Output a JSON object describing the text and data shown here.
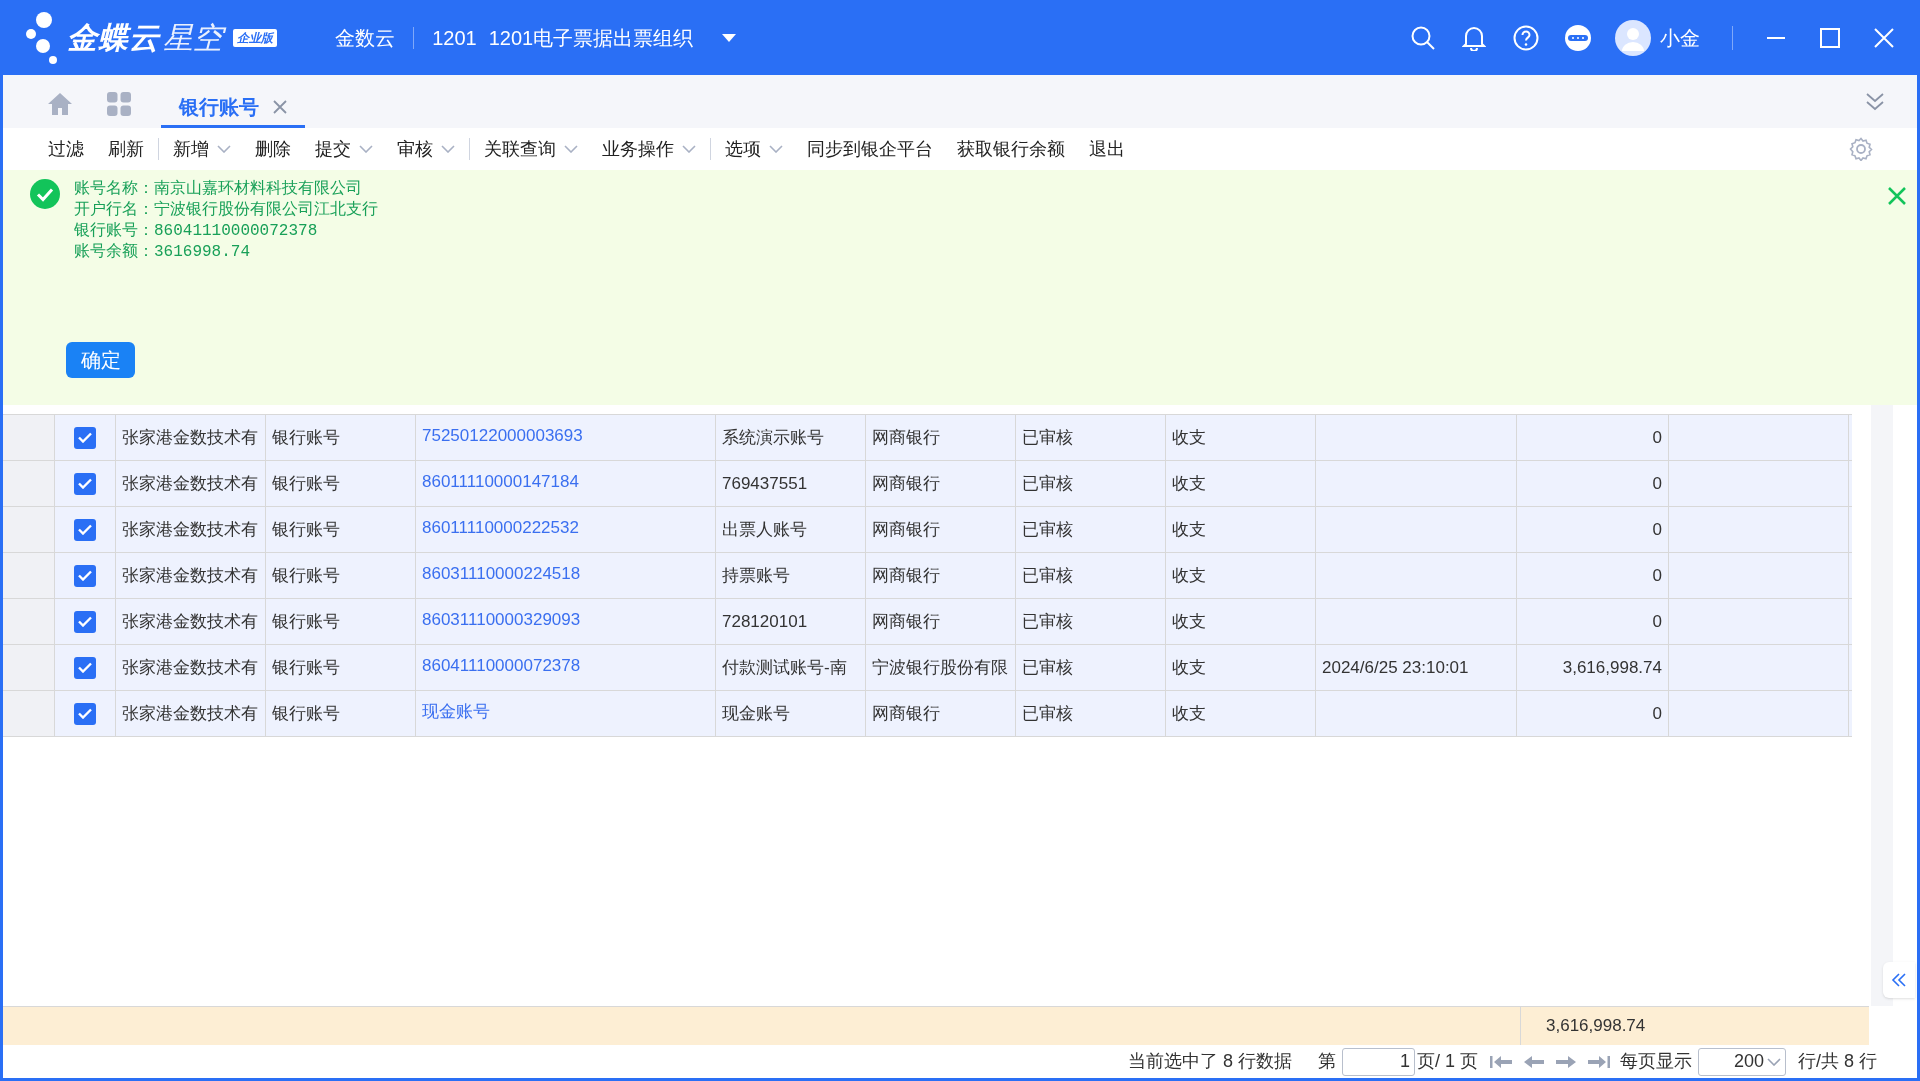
{
  "header": {
    "logo_text": "金蝶云",
    "logo_subtext": "星空",
    "edition_badge": "企业版",
    "org_short": "金数云",
    "org_code": "1201",
    "org_name": "1201电子票据出票组织",
    "user": "小金"
  },
  "tabs": [
    {
      "label": "银行账号",
      "selected": true,
      "closable": true
    }
  ],
  "toolbar": [
    [
      {
        "label": "过滤",
        "dropdown": false
      },
      {
        "label": "刷新",
        "dropdown": false
      }
    ],
    [
      {
        "label": "新增",
        "dropdown": true
      },
      {
        "label": "删除",
        "dropdown": false
      },
      {
        "label": "提交",
        "dropdown": true
      },
      {
        "label": "审核",
        "dropdown": true
      }
    ],
    [
      {
        "label": "关联查询",
        "dropdown": true
      },
      {
        "label": "业务操作",
        "dropdown": true
      }
    ],
    [
      {
        "label": "选项",
        "dropdown": true
      },
      {
        "label": "同步到银企平台",
        "dropdown": false
      },
      {
        "label": "获取银行余额",
        "dropdown": false
      },
      {
        "label": "退出",
        "dropdown": false
      }
    ]
  ],
  "message": {
    "kind": "success",
    "lines": [
      "账号名称：南京山嘉环材料科技有限公司",
      "开户行名：宁波银行股份有限公司江北支行",
      "银行账号：86041110000072378",
      "账号余额：3616998.74"
    ],
    "button": "确定"
  },
  "table": {
    "columns": [
      {
        "kind": "text"
      },
      {
        "kind": "text"
      },
      {
        "kind": "link"
      },
      {
        "kind": "text"
      },
      {
        "kind": "text"
      },
      {
        "kind": "text"
      },
      {
        "kind": "text"
      },
      {
        "kind": "text"
      },
      {
        "kind": "number"
      },
      {
        "kind": "text"
      }
    ],
    "rows": [
      {
        "checked": true,
        "cells": [
          "张家港金数技术有",
          "银行账号",
          "75250122000003693",
          "系统演示账号",
          "网商银行",
          "已审核",
          "收支",
          "",
          "0",
          ""
        ]
      },
      {
        "checked": true,
        "cells": [
          "张家港金数技术有",
          "银行账号",
          "86011110000147184",
          "769437551",
          "网商银行",
          "已审核",
          "收支",
          "",
          "0",
          ""
        ]
      },
      {
        "checked": true,
        "cells": [
          "张家港金数技术有",
          "银行账号",
          "86011110000222532",
          "出票人账号",
          "网商银行",
          "已审核",
          "收支",
          "",
          "0",
          ""
        ]
      },
      {
        "checked": true,
        "cells": [
          "张家港金数技术有",
          "银行账号",
          "86031110000224518",
          "持票账号",
          "网商银行",
          "已审核",
          "收支",
          "",
          "0",
          ""
        ]
      },
      {
        "checked": true,
        "cells": [
          "张家港金数技术有",
          "银行账号",
          "86031110000329093",
          "728120101",
          "网商银行",
          "已审核",
          "收支",
          "",
          "0",
          ""
        ]
      },
      {
        "checked": true,
        "cells": [
          "张家港金数技术有",
          "银行账号",
          "86041110000072378",
          "付款测试账号-南",
          "宁波银行股份有限",
          "已审核",
          "收支",
          "2024/6/25 23:10:01",
          "3,616,998.74",
          ""
        ]
      },
      {
        "checked": true,
        "cells": [
          "张家港金数技术有",
          "银行账号",
          "现金账号",
          "现金账号",
          "网商银行",
          "已审核",
          "收支",
          "",
          "0",
          ""
        ]
      }
    ],
    "total": "3,616,998.74"
  },
  "pager": {
    "selection_info": "当前选中了 8 行数据",
    "page_prefix": "第",
    "page": "1",
    "page_suffix": "页/ 1 页",
    "page_size_label": "每页显示",
    "page_size": "200",
    "total_label": "行/共 8 行"
  }
}
